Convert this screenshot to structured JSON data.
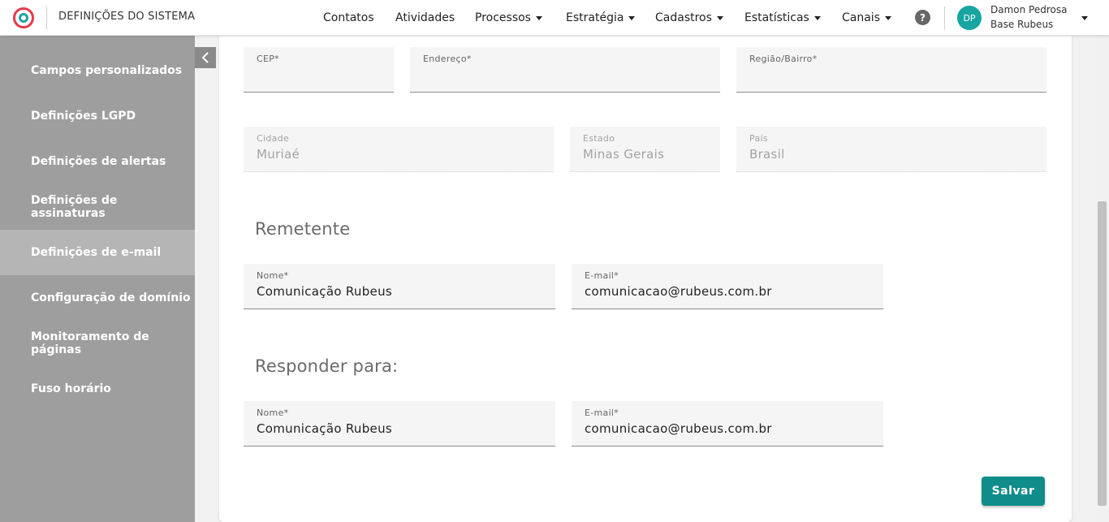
{
  "app": {
    "title": "DEFINIÇÕES DO SISTEMA"
  },
  "nav": {
    "contatos": "Contatos",
    "atividades": "Atividades",
    "processos": "Processos",
    "estrategia": "Estratégia",
    "cadastros": "Cadastros",
    "estatisticas": "Estatísticas",
    "canais": "Canais"
  },
  "user": {
    "initials": "DP",
    "name": "Damon Pedrosa",
    "base": "Base Rubeus"
  },
  "sidebar": {
    "items": [
      {
        "label": "Campos personalizados"
      },
      {
        "label": "Definições LGPD"
      },
      {
        "label": "Definições de alertas"
      },
      {
        "label": "Definições de assinaturas"
      },
      {
        "label": "Definições de e-mail"
      },
      {
        "label": "Configuração de domínio"
      },
      {
        "label": "Monitoramento de páginas"
      },
      {
        "label": "Fuso horário"
      }
    ],
    "active_index": 4
  },
  "address": {
    "cep": {
      "label": "CEP*",
      "value": ""
    },
    "endereco": {
      "label": "Endereço*",
      "value": ""
    },
    "regiao": {
      "label": "Região/Bairro*",
      "value": ""
    },
    "cidade": {
      "label": "Cidade",
      "value": "Muriaé"
    },
    "estado": {
      "label": "Estado",
      "value": "Minas Gerais"
    },
    "pais": {
      "label": "País",
      "value": "Brasil"
    }
  },
  "remetente": {
    "title": "Remetente",
    "nome": {
      "label": "Nome*",
      "value": "Comunicação Rubeus"
    },
    "email": {
      "label": "E-mail*",
      "value": "comunicacao@rubeus.com.br"
    }
  },
  "responder": {
    "title": "Responder para:",
    "nome": {
      "label": "Nome*",
      "value": "Comunicação Rubeus"
    },
    "email": {
      "label": "E-mail*",
      "value": "comunicacao@rubeus.com.br"
    }
  },
  "actions": {
    "save": "Salvar"
  },
  "colors": {
    "accent": "#0f8d8a",
    "sidebar": "#9e9e9e",
    "sidebar_active": "#b5b5b5",
    "avatar": "#16a5a0"
  }
}
